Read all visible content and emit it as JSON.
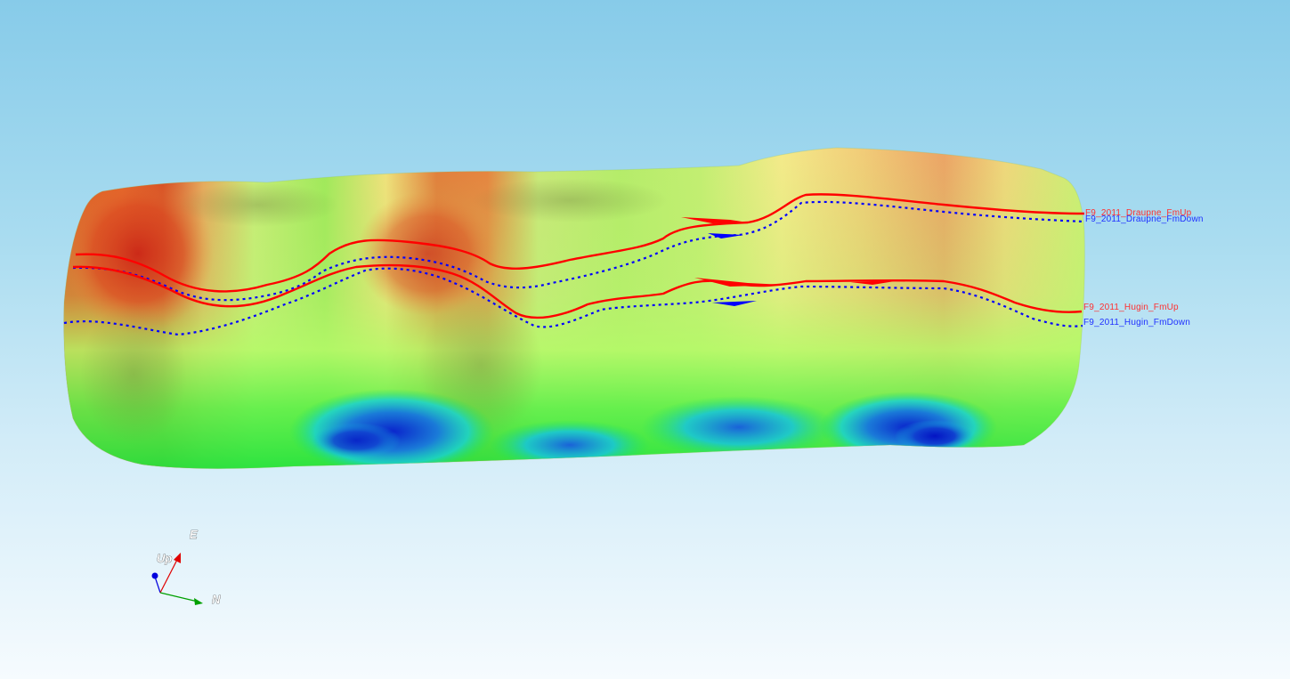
{
  "viewer": {
    "background_top": "#87cbe9",
    "background_bottom": "#f6fbfe",
    "surface_colormap": [
      "#0a1fd0",
      "#13c8e0",
      "#19e62c",
      "#b4ff6a",
      "#f2ec8a",
      "#f0a05a",
      "#d9301c"
    ]
  },
  "horizons": [
    {
      "id": "draupne-up",
      "label": "F9_2011_Draupne_FmUp",
      "color": "#ff0000"
    },
    {
      "id": "draupne-down",
      "label": "F9_2011_Draupne_FmDown",
      "color": "#0000ff"
    },
    {
      "id": "hugin-up",
      "label": "F9_2011_Hugin_FmUp",
      "color": "#ff0000"
    },
    {
      "id": "hugin-down",
      "label": "F9_2011_Hugin_FmDown",
      "color": "#0000ff"
    }
  ],
  "axes": {
    "east_label": "E",
    "up_label": "Up",
    "north_label": "N",
    "east_color": "#0000dd",
    "up_color": "#e00000",
    "north_color": "#00a000"
  }
}
